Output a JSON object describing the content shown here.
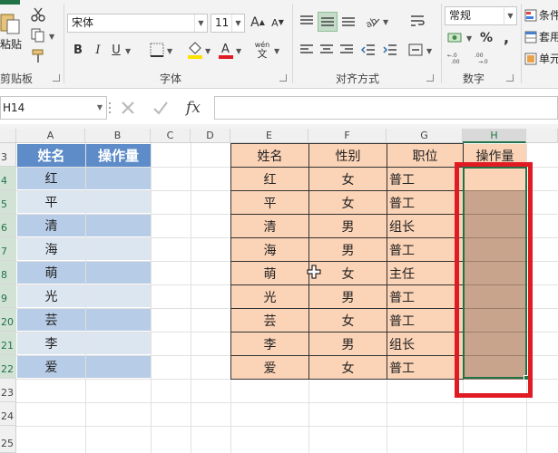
{
  "ribbon": {
    "clipboard": {
      "paste_label": "粘贴",
      "cut_icon": "scissors-icon",
      "copy_icon": "copy-icon",
      "format_painter_icon": "brush-icon",
      "group_label": "剪贴板"
    },
    "font": {
      "font_name": "宋体",
      "font_size": "11",
      "bold": "B",
      "italic": "I",
      "underline": "U",
      "grow": "A",
      "shrink": "A",
      "phonetic": "wén",
      "group_label": "字体",
      "font_color": "#e01b24",
      "fill_color": "#ffe100"
    },
    "alignment": {
      "group_label": "对齐方式"
    },
    "number": {
      "format": "常规",
      "percent": "%",
      "comma": ",",
      "inc_decimal": ".0→.00",
      "dec_decimal": ".00→.0",
      "group_label": "数字"
    },
    "styles": {
      "conditional_format": "条件",
      "table_format": "套用",
      "cell_style": "单元"
    }
  },
  "formula_bar": {
    "name_box": "H14",
    "fx": "fx",
    "formula": ""
  },
  "columns": {
    "A": "A",
    "B": "B",
    "C": "C",
    "D": "D",
    "E": "E",
    "F": "F",
    "G": "G",
    "H": "H"
  },
  "row_numbers": [
    "3",
    "4",
    "5",
    "6",
    "7",
    "8",
    "9",
    "20",
    "21",
    "22",
    "23",
    "24",
    "25"
  ],
  "left_table": {
    "headers": [
      "姓名",
      "操作量"
    ],
    "names": [
      "红",
      "平",
      "清",
      "海",
      "萌",
      "光",
      "芸",
      "李",
      "爱"
    ]
  },
  "right_table": {
    "headers": [
      "姓名",
      "性别",
      "职位",
      "操作量"
    ],
    "rows": [
      [
        "红",
        "女",
        "普工"
      ],
      [
        "平",
        "女",
        "普工"
      ],
      [
        "清",
        "男",
        "组长"
      ],
      [
        "海",
        "男",
        "普工"
      ],
      [
        "萌",
        "女",
        "主任"
      ],
      [
        "光",
        "男",
        "普工"
      ],
      [
        "芸",
        "女",
        "普工"
      ],
      [
        "李",
        "男",
        "组长"
      ],
      [
        "爱",
        "女",
        "普工"
      ]
    ]
  },
  "colors": {
    "excel_green": "#217346",
    "header_blue": "#5d8cc8",
    "peach": "#fbd3b6",
    "brown_fill": "#c9a48c",
    "highlight_red": "#e01b24"
  }
}
